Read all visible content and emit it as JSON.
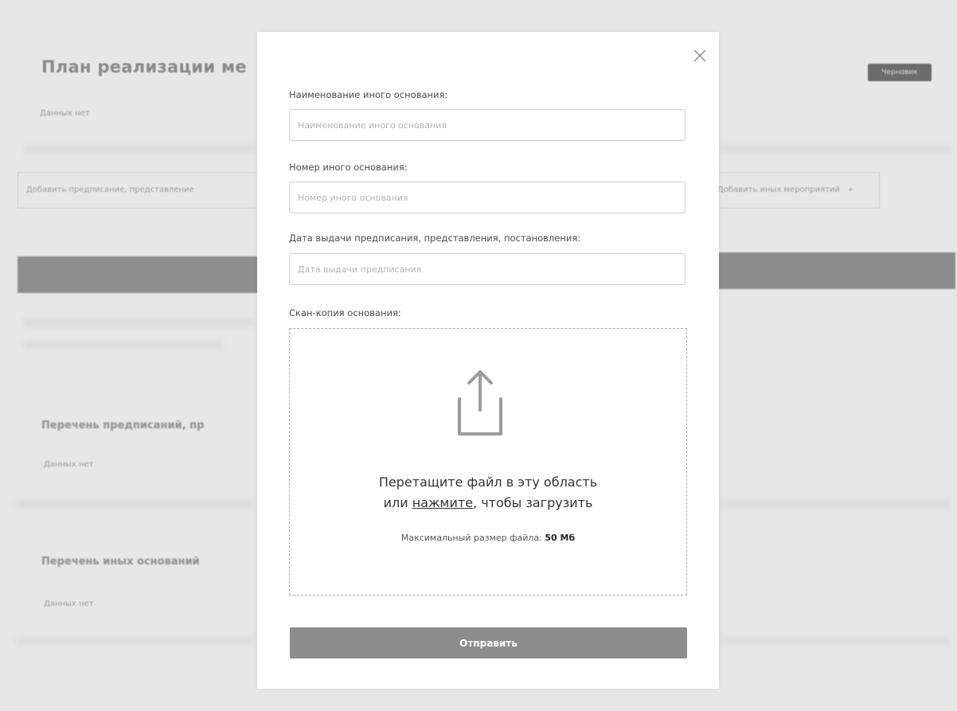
{
  "background": {
    "heading": "План реализации ме",
    "badge": "Черновик",
    "no_data_1": "Данных нет",
    "add_left": "Добавить предписание, представление",
    "add_right": "Добавить иных мероприятий",
    "add_right_plus": "+",
    "section_1": "Перечень предписаний, пр",
    "no_data_2": "Данных нет",
    "section_2": "Перечень иных оснований",
    "no_data_3": "Данных нет"
  },
  "modal": {
    "fields": [
      {
        "label": "Наименование иного основания:",
        "placeholder": "Наименование иного основания",
        "value": ""
      },
      {
        "label": "Номер иного основания:",
        "placeholder": "Номер иного основания",
        "value": ""
      },
      {
        "label": "Дата выдачи предписания, представления, постановления:",
        "placeholder": "Дата выдачи предписания",
        "value": ""
      }
    ],
    "scan_label": "Скан-копия основания:",
    "dropzone": {
      "line1": "Перетащите файл в эту область",
      "line2_prefix": "или ",
      "line2_link": "нажмите",
      "line2_suffix": ", чтобы загрузить",
      "max_prefix": "Максимальный размер файла: ",
      "max_value": "50 Мб"
    },
    "submit_label": "Отправить",
    "icons": {
      "close": "close-icon",
      "upload": "upload-icon"
    }
  },
  "colors": {
    "backdrop": "#e4e4e4",
    "submit_bg": "#8d8d8d",
    "input_border": "#cdcdcd"
  }
}
